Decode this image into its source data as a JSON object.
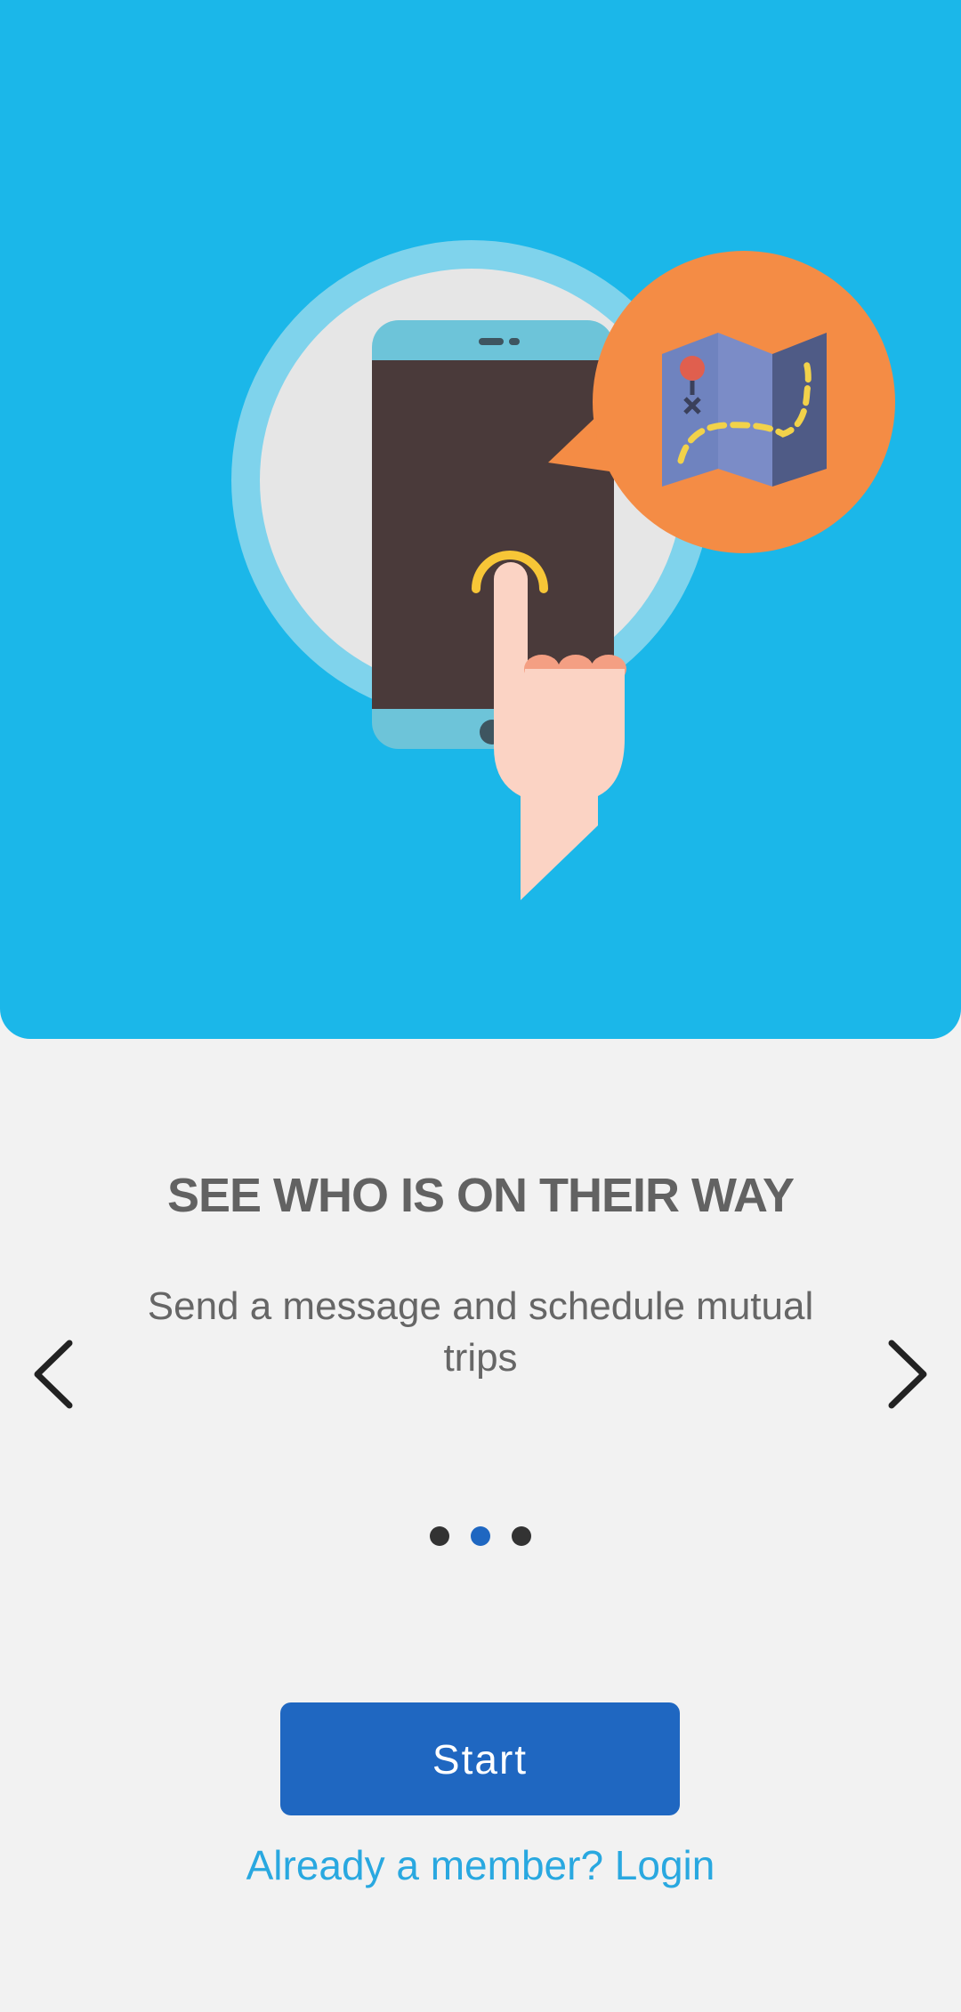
{
  "onboarding": {
    "headline": "SEE WHO IS ON THEIR WAY",
    "description": "Send a message and schedule mutual trips",
    "slide_count": 3,
    "active_slide": 2
  },
  "navigation": {
    "prev_icon": "chevron-left-icon",
    "next_icon": "chevron-right-icon"
  },
  "actions": {
    "start_label": "Start",
    "login_label": "Already a member? Login"
  },
  "colors": {
    "hero_background": "#1bb7e9",
    "primary": "#1f67c1",
    "link": "#29a8e0",
    "page_background": "#f2f2f2"
  }
}
